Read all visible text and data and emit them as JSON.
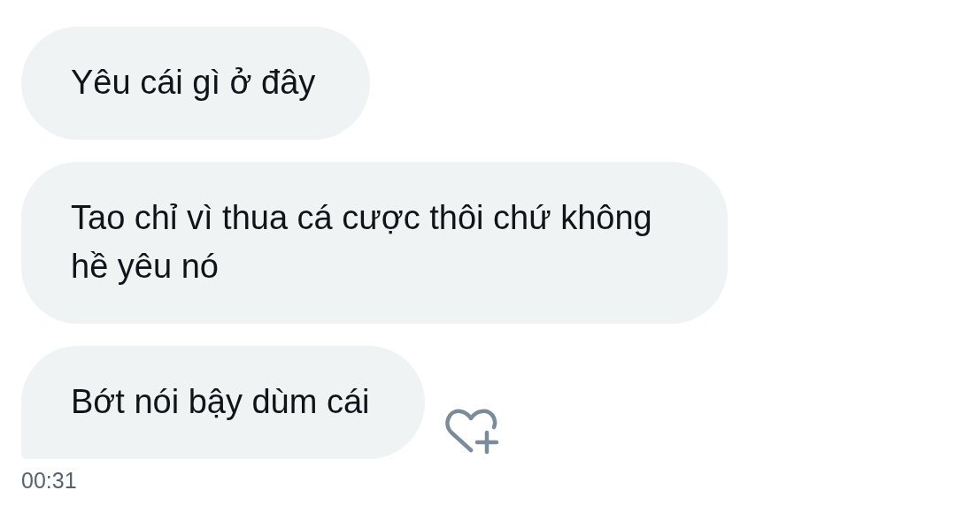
{
  "messages": [
    {
      "text": "Yêu cái gì ở đây",
      "last_in_group": false
    },
    {
      "text": "Tao chỉ vì thua cá cược thôi chứ không hề yêu nó",
      "last_in_group": false
    },
    {
      "text": "Bớt nói bậy dùm cái",
      "last_in_group": true
    }
  ],
  "timestamp": "00:31"
}
